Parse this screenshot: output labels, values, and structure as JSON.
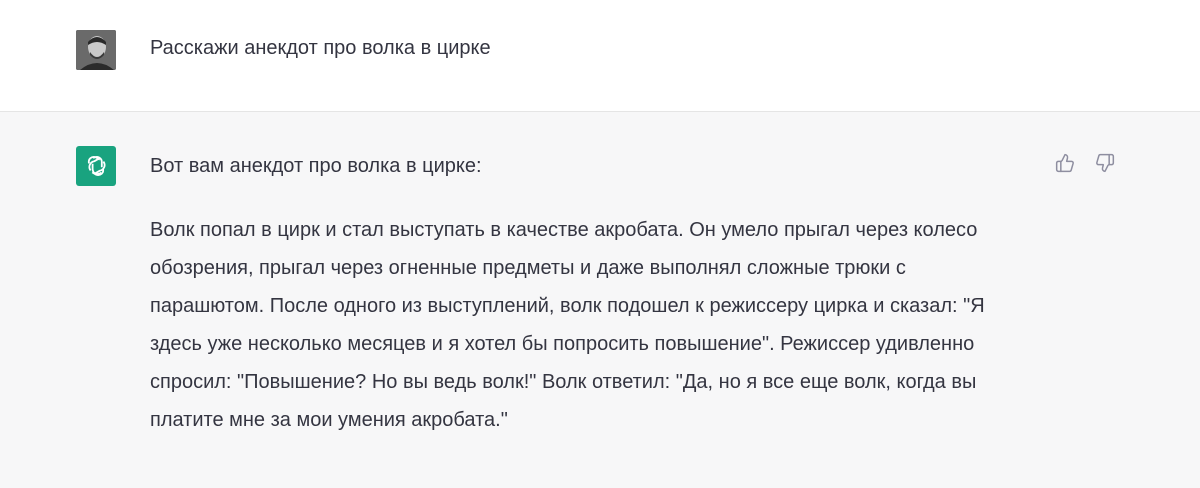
{
  "user_message": {
    "avatar": "user-photo-avatar",
    "text": "Расскажи анекдот про волка в цирке"
  },
  "assistant_message": {
    "avatar": "openai-logo-icon",
    "intro": "Вот вам анекдот про волка в цирке:",
    "body": "Волк попал в цирк и стал выступать в качестве акробата. Он умело прыгал через колесо обозрения, прыгал через огненные предметы и даже выполнял сложные трюки с парашютом. После одного из выступлений, волк подошел к режиссеру цирка и сказал: \"Я здесь уже несколько месяцев и я хотел бы попросить повышение\". Режиссер удивленно спросил: \"Повышение? Но вы ведь волк!\" Волк ответил: \"Да, но я все еще волк, когда вы платите мне за мои умения акробата.\"",
    "feedback": {
      "like_icon": "thumbs-up-icon",
      "dislike_icon": "thumbs-down-icon"
    }
  },
  "colors": {
    "assistant_bg": "#f7f7f8",
    "text": "#343541",
    "bot_avatar": "#19a37f",
    "icon": "#8e8ea0"
  }
}
